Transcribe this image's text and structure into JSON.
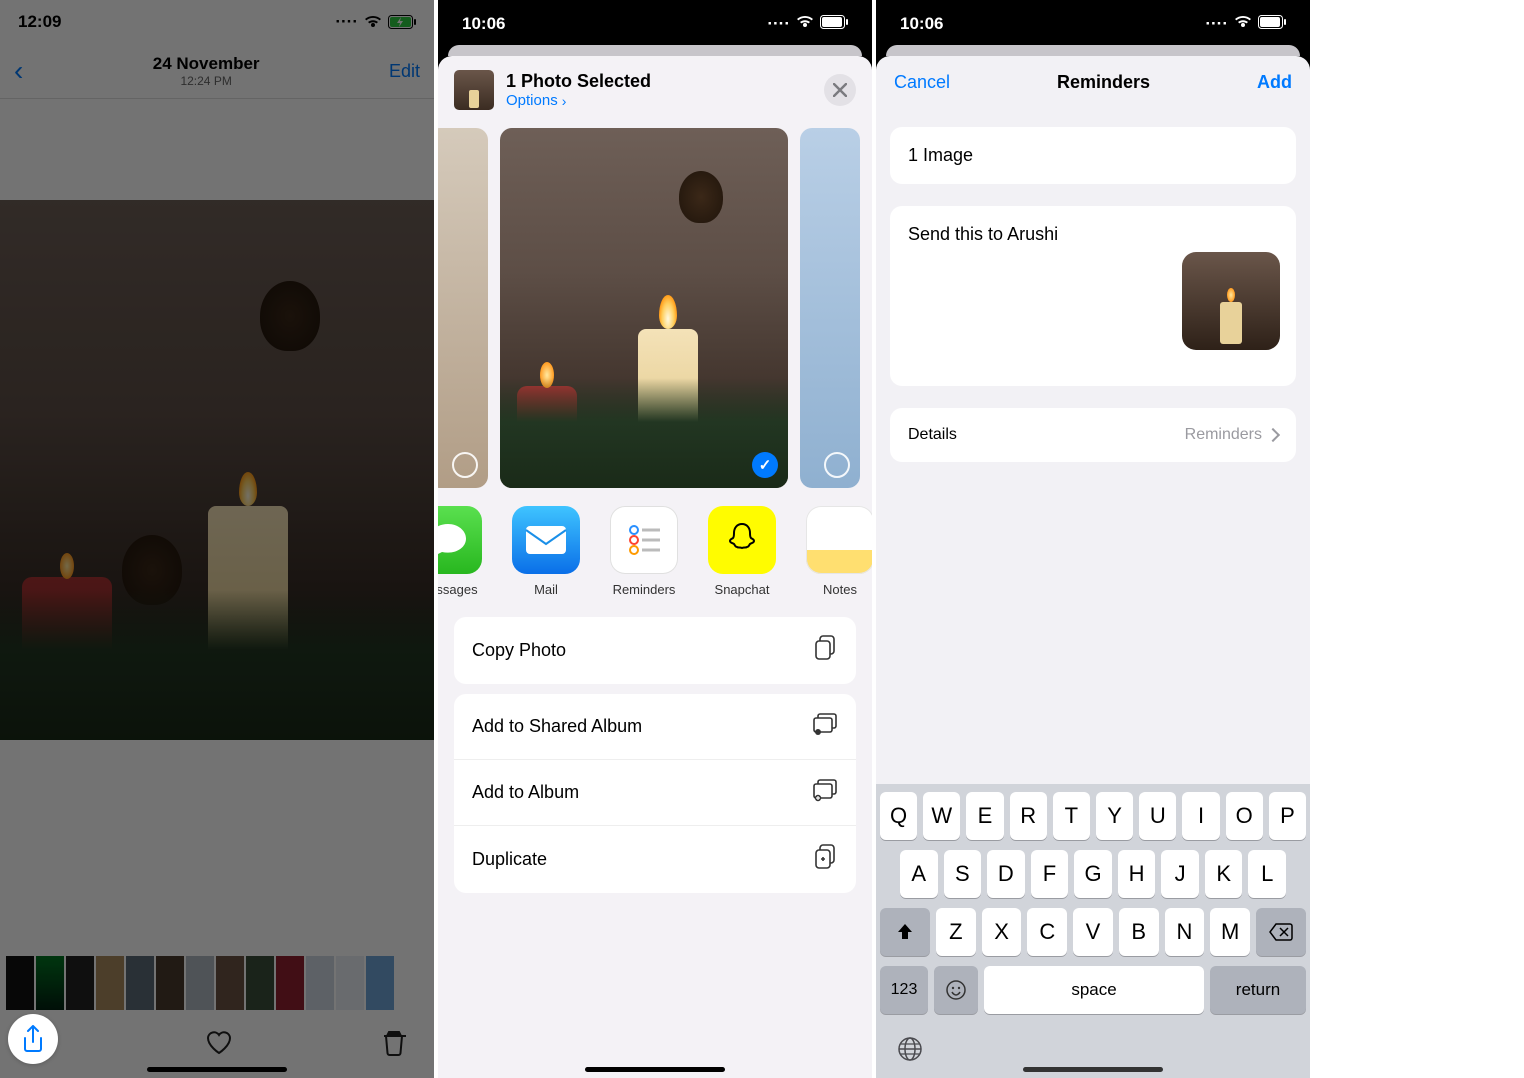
{
  "phone1": {
    "status": {
      "time": "12:09"
    },
    "nav": {
      "date": "24 November",
      "time": "12:24 PM",
      "edit": "Edit"
    }
  },
  "phone2": {
    "status": {
      "time": "10:06"
    },
    "header": {
      "title": "1 Photo Selected",
      "options": "Options"
    },
    "apps": [
      {
        "label": "Messages"
      },
      {
        "label": "Mail"
      },
      {
        "label": "Reminders"
      },
      {
        "label": "Snapchat"
      },
      {
        "label": "Notes"
      }
    ],
    "actions": {
      "copy": "Copy Photo",
      "shared_album": "Add to Shared Album",
      "album": "Add to Album",
      "duplicate": "Duplicate"
    }
  },
  "phone3": {
    "status": {
      "time": "10:06"
    },
    "nav": {
      "cancel": "Cancel",
      "title": "Reminders",
      "add": "Add"
    },
    "summary": "1 Image",
    "note": "Send this to Arushi",
    "details": {
      "label": "Details",
      "value": "Reminders"
    },
    "keyboard": {
      "row1": [
        "Q",
        "W",
        "E",
        "R",
        "T",
        "Y",
        "U",
        "I",
        "O",
        "P"
      ],
      "row2": [
        "A",
        "S",
        "D",
        "F",
        "G",
        "H",
        "J",
        "K",
        "L"
      ],
      "row3": [
        "Z",
        "X",
        "C",
        "V",
        "B",
        "N",
        "M"
      ],
      "k123": "123",
      "space": "space",
      "ret": "return"
    }
  }
}
